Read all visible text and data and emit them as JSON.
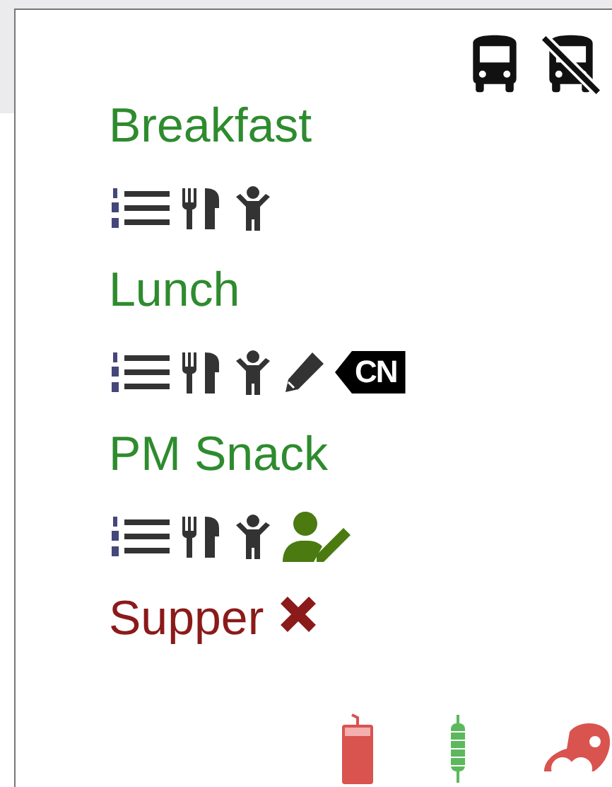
{
  "transport_icons": [
    {
      "kind": "bus"
    },
    {
      "kind": "bus-slash"
    }
  ],
  "meals": [
    {
      "name": "Breakfast",
      "color": "#2e8b2e",
      "icons": [
        {
          "kind": "numbered-list"
        },
        {
          "kind": "utensils"
        },
        {
          "kind": "child"
        }
      ]
    },
    {
      "name": "Lunch",
      "color": "#2e8b2e",
      "icons": [
        {
          "kind": "numbered-list"
        },
        {
          "kind": "utensils"
        },
        {
          "kind": "child"
        },
        {
          "kind": "pencil"
        },
        {
          "kind": "badge",
          "text": "CN"
        }
      ]
    },
    {
      "name": "PM Snack",
      "color": "#2e8b2e",
      "icons": [
        {
          "kind": "numbered-list"
        },
        {
          "kind": "utensils"
        },
        {
          "kind": "child"
        },
        {
          "kind": "user-edit"
        }
      ]
    },
    {
      "name": "Supper",
      "color": "#8b1a1a",
      "icons": [
        {
          "kind": "cross"
        }
      ]
    }
  ],
  "food_groups": [
    {
      "kind": "drink",
      "color": "#d9534f"
    },
    {
      "kind": "grain",
      "color": "#5cb85c"
    },
    {
      "kind": "meat",
      "color": "#d9534f"
    }
  ]
}
